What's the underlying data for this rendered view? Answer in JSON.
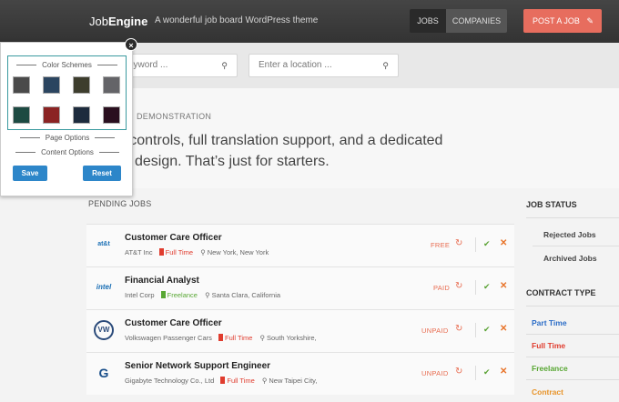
{
  "header": {
    "brand_light": "Job",
    "brand_bold": "Engine",
    "tagline": "A wonderful job board WordPress theme",
    "nav": [
      "JOBS",
      "COMPANIES"
    ],
    "post_job": "POST A JOB"
  },
  "search": {
    "keyword_placeholder": "eyword ...",
    "location_placeholder": "Enter a location ..."
  },
  "hero": {
    "label": "DEMONSTRATION",
    "text_line1": "nd controls, full translation support, and a dedicated",
    "text_line2": "design. That’s just for starters."
  },
  "pending": {
    "title": "PENDING JOBS",
    "jobs": [
      {
        "title": "Customer Care Officer",
        "company": "AT&T Inc",
        "type": "Full Time",
        "location": "New York, New York",
        "status": "FREE",
        "logo": "at&t"
      },
      {
        "title": "Financial Analyst",
        "company": "Intel Corp",
        "type": "Freelance",
        "location": "Santa Clara, California",
        "status": "PAID",
        "logo": "intel"
      },
      {
        "title": "Customer Care Officer",
        "company": "Volkswagen Passenger Cars",
        "type": "Full Time",
        "location": "South Yorkshire,",
        "status": "UNPAID",
        "logo": "VW"
      },
      {
        "title": "Senior Network Support Engineer",
        "company": "Gigabyte Technology Co., Ltd",
        "type": "Full Time",
        "location": "New Taipei City,",
        "status": "UNPAID",
        "logo": "G"
      }
    ]
  },
  "sidebar": {
    "job_status_title": "JOB STATUS",
    "job_status": [
      "Rejected Jobs",
      "Archived Jobs"
    ],
    "contract_title": "CONTRACT TYPE",
    "contract_types": [
      "Part Time",
      "Full Time",
      "Freelance",
      "Contract"
    ]
  },
  "panel": {
    "color_schemes": "Color Schemes",
    "page_options": "Page Options",
    "content_options": "Content Options",
    "save": "Save",
    "reset": "Reset",
    "close": "×",
    "swatches": [
      "#4a4a4a",
      "#2b4560",
      "#3d3d2d",
      "#646468",
      "#1d4a42",
      "#8b2323",
      "#1d2b3d",
      "#2a0f1f"
    ]
  },
  "colors": {
    "freelance": "#58a733",
    "full_time": "#e03c2e",
    "part_time": "#2a6cc7",
    "contract": "#e8942a",
    "accent": "#e76d5e"
  }
}
